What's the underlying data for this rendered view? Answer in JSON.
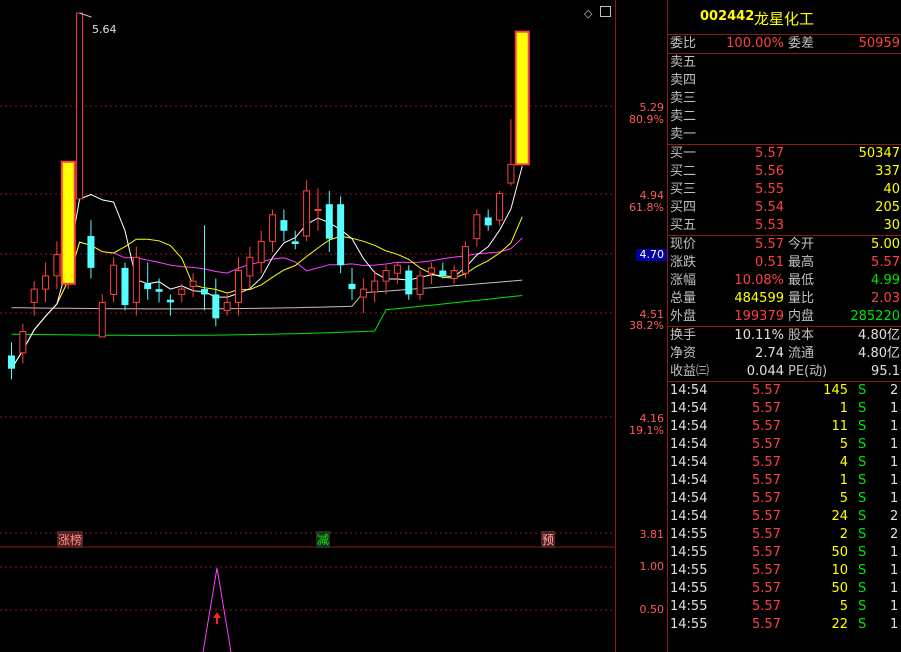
{
  "stock": {
    "code": "002442",
    "name": "龙星化工"
  },
  "chart": {
    "high_marker": "5.64",
    "axis_labels": {
      "p529": "5.29",
      "pct809": "80.9%",
      "p494": "4.94",
      "pct618": "61.8%",
      "p470": "4.70",
      "p451": "4.51",
      "pct382": "38.2%",
      "p416": "4.16",
      "pct191": "19.1%",
      "p381": "3.81"
    },
    "indicator_axis": {
      "v100": "1.00",
      "v050": "0.50"
    },
    "markers": {
      "zhangbang": "涨榜",
      "jian": "减",
      "yu": "预"
    },
    "colors": {
      "up": "#ff4040",
      "down": "#54ffff",
      "limit": "#ffff00",
      "ma5": "#ffffff",
      "ma10": "#ffff00",
      "ma20": "#ff40ff",
      "ma60": "#c0c0c0",
      "ma120": "#00e600",
      "grid": "#8b1a1a"
    }
  },
  "quote": {
    "weibi_label": "委比",
    "weibi_value": "100.00%",
    "weicha_label": "委差",
    "weicha_value": "50959",
    "sell": [
      "卖五",
      "卖四",
      "卖三",
      "卖二",
      "卖一"
    ],
    "buy": [
      {
        "label": "买一",
        "price": "5.57",
        "vol": "50347"
      },
      {
        "label": "买二",
        "price": "5.56",
        "vol": "337"
      },
      {
        "label": "买三",
        "price": "5.55",
        "vol": "40"
      },
      {
        "label": "买四",
        "price": "5.54",
        "vol": "205"
      },
      {
        "label": "买五",
        "price": "5.53",
        "vol": "30"
      }
    ],
    "stats": [
      {
        "l1": "现价",
        "v1": "5.57",
        "c1": "red",
        "l2": "今开",
        "v2": "5.00",
        "c2": "yel"
      },
      {
        "l1": "涨跌",
        "v1": "0.51",
        "c1": "red",
        "l2": "最高",
        "v2": "5.57",
        "c2": "red"
      },
      {
        "l1": "涨幅",
        "v1": "10.08%",
        "c1": "red",
        "l2": "最低",
        "v2": "4.99",
        "c2": "green"
      },
      {
        "l1": "总量",
        "v1": "484599",
        "c1": "yel",
        "l2": "量比",
        "v2": "2.03",
        "c2": "red"
      },
      {
        "l1": "外盘",
        "v1": "199379",
        "c1": "red",
        "l2": "内盘",
        "v2": "285220",
        "c2": "green"
      }
    ],
    "fund": [
      {
        "l1": "换手",
        "v1": "10.11%",
        "l2": "股本",
        "v2": "4.80亿"
      },
      {
        "l1": "净资",
        "v1": "2.74",
        "l2": "流通",
        "v2": "4.80亿"
      },
      {
        "l1": "收益㈢",
        "v1": "0.044",
        "l2": "PE(动)",
        "v2": "95.1"
      }
    ],
    "ticks": [
      {
        "time": "14:54",
        "price": "5.57",
        "vol": "145",
        "bs": "S",
        "cnt": "2"
      },
      {
        "time": "14:54",
        "price": "5.57",
        "vol": "1",
        "bs": "S",
        "cnt": "1"
      },
      {
        "time": "14:54",
        "price": "5.57",
        "vol": "11",
        "bs": "S",
        "cnt": "1"
      },
      {
        "time": "14:54",
        "price": "5.57",
        "vol": "5",
        "bs": "S",
        "cnt": "1"
      },
      {
        "time": "14:54",
        "price": "5.57",
        "vol": "4",
        "bs": "S",
        "cnt": "1"
      },
      {
        "time": "14:54",
        "price": "5.57",
        "vol": "1",
        "bs": "S",
        "cnt": "1"
      },
      {
        "time": "14:54",
        "price": "5.57",
        "vol": "5",
        "bs": "S",
        "cnt": "1"
      },
      {
        "time": "14:54",
        "price": "5.57",
        "vol": "24",
        "bs": "S",
        "cnt": "2"
      },
      {
        "time": "14:55",
        "price": "5.57",
        "vol": "2",
        "bs": "S",
        "cnt": "2"
      },
      {
        "time": "14:55",
        "price": "5.57",
        "vol": "50",
        "bs": "S",
        "cnt": "1"
      },
      {
        "time": "14:55",
        "price": "5.57",
        "vol": "10",
        "bs": "S",
        "cnt": "1"
      },
      {
        "time": "14:55",
        "price": "5.57",
        "vol": "50",
        "bs": "S",
        "cnt": "1"
      },
      {
        "time": "14:55",
        "price": "5.57",
        "vol": "5",
        "bs": "S",
        "cnt": "1"
      },
      {
        "time": "14:55",
        "price": "5.57",
        "vol": "22",
        "bs": "S",
        "cnt": "1"
      }
    ]
  },
  "candles": [
    {
      "o": 4.35,
      "h": 4.4,
      "l": 4.26,
      "c": 4.3
    },
    {
      "o": 4.36,
      "h": 4.47,
      "l": 4.32,
      "c": 4.44
    },
    {
      "o": 4.55,
      "h": 4.63,
      "l": 4.5,
      "c": 4.6
    },
    {
      "o": 4.6,
      "h": 4.7,
      "l": 4.55,
      "c": 4.65
    },
    {
      "o": 4.65,
      "h": 4.78,
      "l": 4.6,
      "c": 4.73
    },
    {
      "o": 4.62,
      "h": 5.08,
      "l": 4.6,
      "c": 5.08
    },
    {
      "o": 4.94,
      "h": 5.64,
      "l": 4.94,
      "c": 5.64
    },
    {
      "o": 4.8,
      "h": 4.86,
      "l": 4.64,
      "c": 4.68
    },
    {
      "o": 4.42,
      "h": 4.58,
      "l": 4.42,
      "c": 4.55
    },
    {
      "o": 4.58,
      "h": 4.72,
      "l": 4.55,
      "c": 4.69
    },
    {
      "o": 4.68,
      "h": 4.7,
      "l": 4.52,
      "c": 4.54
    },
    {
      "o": 4.55,
      "h": 4.76,
      "l": 4.5,
      "c": 4.72
    },
    {
      "o": 4.62,
      "h": 4.7,
      "l": 4.56,
      "c": 4.6
    },
    {
      "o": 4.6,
      "h": 4.64,
      "l": 4.55,
      "c": 4.59
    },
    {
      "o": 4.56,
      "h": 4.58,
      "l": 4.5,
      "c": 4.55
    },
    {
      "o": 4.58,
      "h": 4.62,
      "l": 4.55,
      "c": 4.6
    },
    {
      "o": 4.61,
      "h": 4.66,
      "l": 4.57,
      "c": 4.63
    },
    {
      "o": 4.6,
      "h": 4.84,
      "l": 4.52,
      "c": 4.58
    },
    {
      "o": 4.58,
      "h": 4.64,
      "l": 4.46,
      "c": 4.49
    },
    {
      "o": 4.52,
      "h": 4.58,
      "l": 4.5,
      "c": 4.55
    },
    {
      "o": 4.55,
      "h": 4.72,
      "l": 4.5,
      "c": 4.67
    },
    {
      "o": 4.65,
      "h": 4.76,
      "l": 4.6,
      "c": 4.72
    },
    {
      "o": 4.7,
      "h": 4.82,
      "l": 4.66,
      "c": 4.78
    },
    {
      "o": 4.78,
      "h": 4.9,
      "l": 4.74,
      "c": 4.88
    },
    {
      "o": 4.86,
      "h": 4.9,
      "l": 4.78,
      "c": 4.82
    },
    {
      "o": 4.78,
      "h": 4.82,
      "l": 4.75,
      "c": 4.77
    },
    {
      "o": 4.8,
      "h": 5.01,
      "l": 4.78,
      "c": 4.97
    },
    {
      "o": 4.9,
      "h": 4.98,
      "l": 4.82,
      "c": 4.9
    },
    {
      "o": 4.92,
      "h": 4.97,
      "l": 4.74,
      "c": 4.79
    },
    {
      "o": 4.92,
      "h": 4.95,
      "l": 4.66,
      "c": 4.69
    },
    {
      "o": 4.62,
      "h": 4.68,
      "l": 4.56,
      "c": 4.6
    },
    {
      "o": 4.57,
      "h": 4.64,
      "l": 4.51,
      "c": 4.6
    },
    {
      "o": 4.59,
      "h": 4.67,
      "l": 4.55,
      "c": 4.63
    },
    {
      "o": 4.63,
      "h": 4.69,
      "l": 4.58,
      "c": 4.67
    },
    {
      "o": 4.66,
      "h": 4.7,
      "l": 4.62,
      "c": 4.69
    },
    {
      "o": 4.67,
      "h": 4.69,
      "l": 4.56,
      "c": 4.58
    },
    {
      "o": 4.58,
      "h": 4.67,
      "l": 4.56,
      "c": 4.65
    },
    {
      "o": 4.66,
      "h": 4.7,
      "l": 4.62,
      "c": 4.68
    },
    {
      "o": 4.67,
      "h": 4.7,
      "l": 4.64,
      "c": 4.65
    },
    {
      "o": 4.64,
      "h": 4.69,
      "l": 4.62,
      "c": 4.67
    },
    {
      "o": 4.66,
      "h": 4.78,
      "l": 4.64,
      "c": 4.76
    },
    {
      "o": 4.79,
      "h": 4.9,
      "l": 4.76,
      "c": 4.88
    },
    {
      "o": 4.87,
      "h": 4.9,
      "l": 4.82,
      "c": 4.84
    },
    {
      "o": 4.86,
      "h": 4.97,
      "l": 4.84,
      "c": 4.96
    },
    {
      "o": 5.0,
      "h": 5.24,
      "l": 4.99,
      "c": 5.07
    },
    {
      "o": 5.07,
      "h": 5.57,
      "l": 5.07,
      "c": 5.57
    }
  ],
  "limit_up_indices": [
    5,
    45
  ]
}
